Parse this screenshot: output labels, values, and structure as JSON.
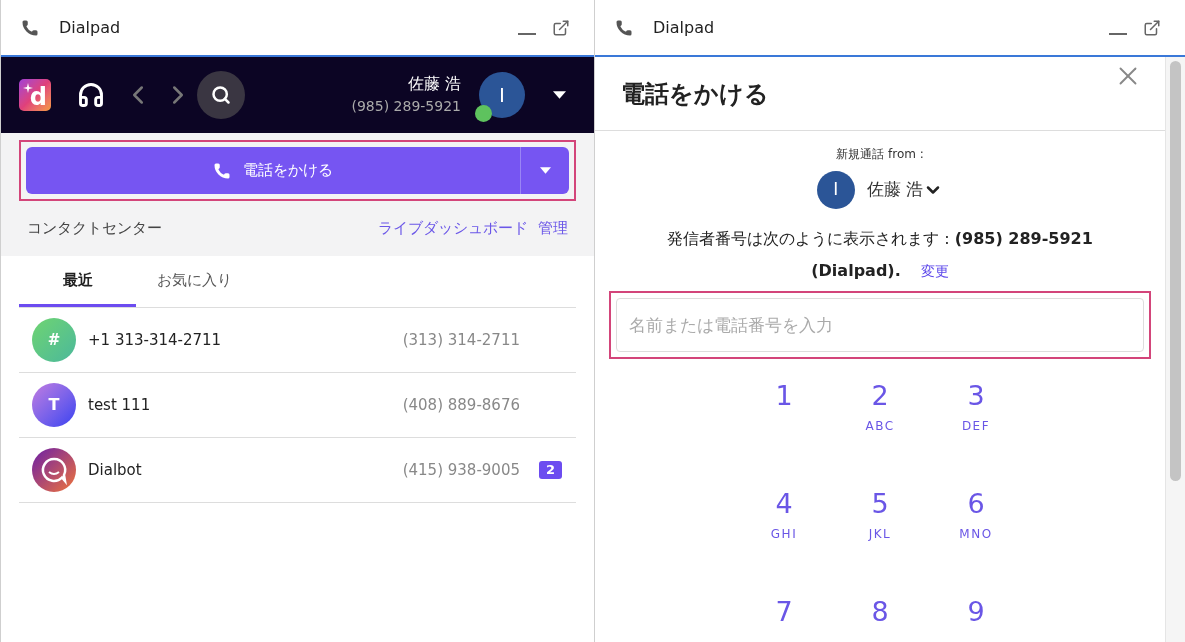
{
  "left_window": {
    "title": "Dialpad",
    "logo_text": "d",
    "user": {
      "name": "佐藤 浩",
      "number": "(985) 289-5921",
      "avatar_initial": "I",
      "online": true
    },
    "call_button": {
      "label": "電話をかける"
    },
    "contact_center": {
      "label": "コンタクトセンター",
      "links": [
        "ライブダッシュボード",
        "管理"
      ]
    },
    "tabs": [
      {
        "label": "最近",
        "selected": true
      },
      {
        "label": "お気に入り",
        "selected": false
      }
    ],
    "contacts": [
      {
        "kind": "number",
        "avatar": "#",
        "name": "+1 313-314-2711",
        "phone": "(313) 314-2711"
      },
      {
        "kind": "initial",
        "avatar": "T",
        "name": "test 111",
        "phone": "(408) 889-8676"
      },
      {
        "kind": "bot",
        "name": "Dialbot",
        "phone": "(415) 938-9005",
        "badge": "2"
      }
    ]
  },
  "right_window": {
    "title": "Dialpad",
    "heading": "電話をかける",
    "from_label": "新規通話 from :",
    "from_user": {
      "avatar_initial": "I",
      "name": "佐藤 浩"
    },
    "caller_id": "発信者番号は次のように表示されます : **(985) 289-5921 (Dialpad).**",
    "change_link": "変更",
    "search": {
      "placeholder": "名前または電話番号を入力"
    },
    "keys": [
      {
        "digit": "1"
      },
      {
        "digit": "2",
        "letters": "ABC"
      },
      {
        "digit": "3",
        "letters": "DEF"
      },
      {
        "digit": "4",
        "letters": "GHI"
      },
      {
        "digit": "5",
        "letters": "JKL"
      },
      {
        "digit": "6",
        "letters": "MNO"
      },
      {
        "digit": "7"
      },
      {
        "digit": "8"
      },
      {
        "digit": "9"
      }
    ]
  }
}
